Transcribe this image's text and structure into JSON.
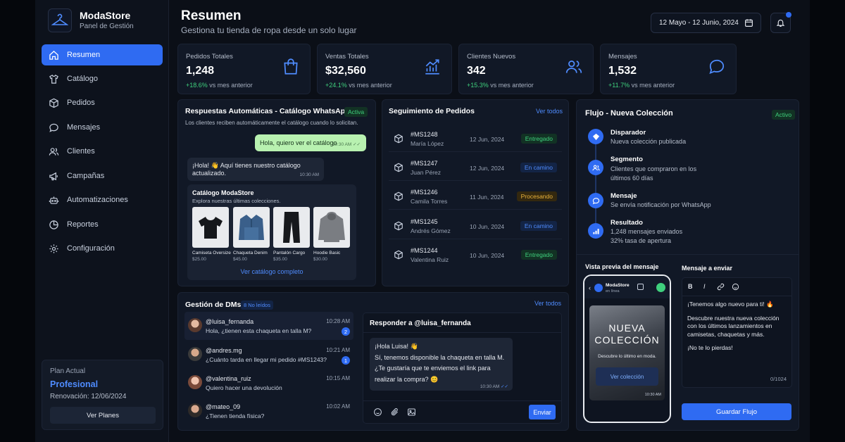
{
  "brand": {
    "name": "ModaStore",
    "subtitle": "Panel de Gestión"
  },
  "nav": [
    {
      "label": "Resumen",
      "icon": "home-icon",
      "active": true
    },
    {
      "label": "Catálogo",
      "icon": "shirt-icon"
    },
    {
      "label": "Pedidos",
      "icon": "box-icon"
    },
    {
      "label": "Mensajes",
      "icon": "chat-icon"
    },
    {
      "label": "Clientes",
      "icon": "users-icon"
    },
    {
      "label": "Campañas",
      "icon": "megaphone-icon"
    },
    {
      "label": "Automatizaciones",
      "icon": "robot-icon"
    },
    {
      "label": "Reportes",
      "icon": "chart-icon"
    },
    {
      "label": "Configuración",
      "icon": "gear-icon"
    }
  ],
  "plan": {
    "label": "Plan Actual",
    "name": "Profesional",
    "renewal": "Renovación: 12/06/2024",
    "button": "Ver Planes"
  },
  "header": {
    "title": "Resumen",
    "subtitle": "Gestiona tu tienda de ropa desde un solo lugar",
    "date_range": "12 Mayo - 12 Junio, 2024"
  },
  "stats": [
    {
      "label": "Pedidos Totales",
      "value": "1,248",
      "change": "+18.6%",
      "suffix": " vs mes anterior",
      "icon": "shopping-bag-icon"
    },
    {
      "label": "Ventas Totales",
      "value": "$32,560",
      "change": "+24.1%",
      "suffix": " vs mes anterior",
      "icon": "trend-chart-icon"
    },
    {
      "label": "Clientes Nuevos",
      "value": "342",
      "change": "+15.3%",
      "suffix": " vs mes anterior",
      "icon": "users-icon"
    },
    {
      "label": "Mensajes",
      "value": "1,532",
      "change": "+11.7%",
      "suffix": " vs mes anterior",
      "icon": "message-icon"
    }
  ],
  "auto": {
    "title": "Respuestas Automáticas - Catálogo WhatsApp",
    "badge": "Activa",
    "desc": "Los clientes reciben automáticamente el catálogo cuando lo solicitan.",
    "out_msg": "Hola, quiero ver el catálogo",
    "out_time": "10:30 AM",
    "in_msg": "¡Hola! 👋 Aquí tienes nuestro catálogo actualizado.",
    "in_time": "10:30 AM",
    "catalog_title": "Catálogo ModaStore",
    "catalog_sub": "Explora nuestras últimas colecciones.",
    "products": [
      {
        "name": "Camiseta Oversize",
        "price": "$25.00"
      },
      {
        "name": "Chaqueta Denim",
        "price": "$45.00"
      },
      {
        "name": "Pantalón Cargo",
        "price": "$35.00"
      },
      {
        "name": "Hoodie Basic",
        "price": "$30.00"
      }
    ],
    "catalog_link": "Ver catálogo completo"
  },
  "orders": {
    "title": "Seguimiento de Pedidos",
    "link": "Ver todos",
    "rows": [
      {
        "id": "#MS1248",
        "name": "María López",
        "date": "12 Jun, 2024",
        "status": "Entregado",
        "kind": "green"
      },
      {
        "id": "#MS1247",
        "name": "Juan Pérez",
        "date": "12 Jun, 2024",
        "status": "En camino",
        "kind": "blue"
      },
      {
        "id": "#MS1246",
        "name": "Camila Torres",
        "date": "11 Jun, 2024",
        "status": "Procesando",
        "kind": "yellow"
      },
      {
        "id": "#MS1245",
        "name": "Andrés Gómez",
        "date": "10 Jun, 2024",
        "status": "En camino",
        "kind": "blue"
      },
      {
        "id": "#MS1244",
        "name": "Valentina Ruiz",
        "date": "10 Jun, 2024",
        "status": "Entregado",
        "kind": "green"
      }
    ]
  },
  "flow": {
    "title": "Flujo - Nueva Colección",
    "badge": "Activo",
    "steps": [
      {
        "title": "Disparador",
        "desc": "Nueva colección publicada"
      },
      {
        "title": "Segmento",
        "desc": "Clientes que compraron en los últimos 60 días"
      },
      {
        "title": "Mensaje",
        "desc": "Se envía notificación por WhatsApp"
      },
      {
        "title": "Resultado",
        "desc": "1,248 mensajes enviados",
        "desc2": "32% tasa de apertura"
      }
    ],
    "preview_label": "Vista previa del mensaje",
    "phone_name": "ModaStore",
    "phone_status": "en línea",
    "promo_title_1": "NUEVA",
    "promo_title_2": "COLECCIÓN",
    "promo_sub": "Descubre lo último en moda.",
    "promo_btn": "Ver colección",
    "promo_time": "10:30 AM",
    "editor_label": "Mensaje a enviar",
    "editor_lines": [
      "¡Tenemos algo nuevo para ti! 🔥",
      "Descubre nuestra nueva colección con los últimos lanzamientos en camisetas, chaquetas y más.",
      "¡No te lo pierdas!"
    ],
    "char_count": "0/1024",
    "save_btn": "Guardar Flujo"
  },
  "dms": {
    "title": "Gestión de DMs",
    "badge": "8 No leídos",
    "link": "Ver todos",
    "items": [
      {
        "user": "@luisa_fernanda",
        "msg": "Hola, ¿tienen esta chaqueta en talla M?",
        "time": "10:28 AM",
        "count": "2"
      },
      {
        "user": "@andres.mg",
        "msg": "¿Cuánto tarda en llegar mi pedido #MS1243?",
        "time": "10:21 AM",
        "count": "1"
      },
      {
        "user": "@valentina_ruiz",
        "msg": "Quiero hacer una devolución",
        "time": "10:15 AM",
        "count": ""
      },
      {
        "user": "@mateo_09",
        "msg": "¿Tienen tienda física?",
        "time": "10:02 AM",
        "count": ""
      }
    ],
    "reply_title": "Responder a @luisa_fernanda",
    "reply_msg": [
      "¡Hola Luisa! 👋",
      "Sí, tenemos disponible la chaqueta en talla M.",
      "¿Te gustaría que te enviemos el link para",
      "realizar la compra? 😊"
    ],
    "reply_time": "10:30 AM",
    "send_btn": "Enviar"
  }
}
